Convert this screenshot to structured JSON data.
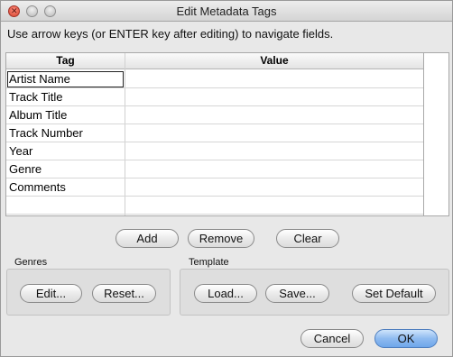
{
  "window": {
    "title": "Edit Metadata Tags"
  },
  "instructions": "Use arrow keys (or ENTER key after editing) to navigate fields.",
  "table": {
    "headers": {
      "tag": "Tag",
      "value": "Value"
    },
    "rows": [
      {
        "tag": "Artist Name",
        "value": ""
      },
      {
        "tag": "Track Title",
        "value": ""
      },
      {
        "tag": "Album Title",
        "value": ""
      },
      {
        "tag": "Track Number",
        "value": ""
      },
      {
        "tag": "Year",
        "value": ""
      },
      {
        "tag": "Genre",
        "value": ""
      },
      {
        "tag": "Comments",
        "value": ""
      },
      {
        "tag": "",
        "value": ""
      }
    ]
  },
  "row_actions": {
    "add": "Add",
    "remove": "Remove",
    "clear": "Clear"
  },
  "genres": {
    "label": "Genres",
    "edit": "Edit...",
    "reset": "Reset..."
  },
  "template": {
    "label": "Template",
    "load": "Load...",
    "save": "Save...",
    "set_default": "Set Default"
  },
  "dialog": {
    "cancel": "Cancel",
    "ok": "OK"
  },
  "colors": {
    "default_button": "#6ea6ea",
    "close_button": "#d4442f"
  }
}
